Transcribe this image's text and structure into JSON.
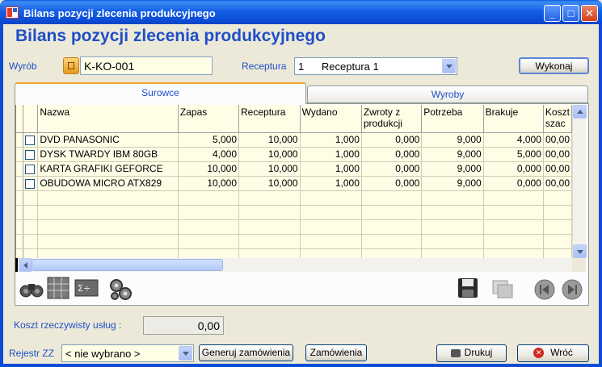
{
  "window": {
    "title": "Bilans pozycji zlecenia produkcyjnego",
    "minimize": "_",
    "maximize": "□",
    "close": "✕"
  },
  "page_title": "Bilans pozycji zlecenia produkcyjnego",
  "product": {
    "label": "Wyrób",
    "value": "K-KO-001",
    "icon": "folder-icon"
  },
  "recipe": {
    "label": "Receptura",
    "value": "1      Receptura 1"
  },
  "execute_button": "Wykonaj",
  "tabs": [
    {
      "label": "Surowce",
      "active": true
    },
    {
      "label": "Wyroby",
      "active": false
    }
  ],
  "table": {
    "columns": [
      "Nazwa",
      "Zapas",
      "Receptura",
      "Wydano",
      "Zwroty z produkcji",
      "Potrzeba",
      "Brakuje",
      "Koszt szac"
    ],
    "rows": [
      [
        "DVD PANASONIC",
        "5,000",
        "10,000",
        "1,000",
        "0,000",
        "9,000",
        "4,000",
        "00,00"
      ],
      [
        "DYSK TWARDY IBM 80GB",
        "4,000",
        "10,000",
        "1,000",
        "0,000",
        "9,000",
        "5,000",
        "00,00"
      ],
      [
        "KARTA GRAFIKI GEFORCE",
        "10,000",
        "10,000",
        "1,000",
        "0,000",
        "9,000",
        "0,000",
        "00,00"
      ],
      [
        "OBUDOWA  MICRO ATX829",
        "10,000",
        "10,000",
        "1,000",
        "0,000",
        "9,000",
        "0,000",
        "00,00"
      ]
    ]
  },
  "toolbar": {
    "left_icons": [
      "binoculars-icon",
      "calculator-grid-icon",
      "formula-icon",
      "gears-icon"
    ],
    "right_icons": [
      "save-disk-icon",
      "copy-icon",
      "first-record-icon",
      "last-record-icon"
    ]
  },
  "cost": {
    "label": "Koszt rzeczywisty usług :",
    "value": "0,00"
  },
  "register": {
    "label": "Rejestr ZZ",
    "value": "< nie wybrano >"
  },
  "buttons": {
    "generate_orders": "Generuj zamówienia",
    "orders": "Zamówienia",
    "print": "Drukuj",
    "back": "Wróć"
  },
  "colors": {
    "accent": "#1f4fc8",
    "grid_bg": "#fffde6",
    "window": "#ece9d8"
  }
}
